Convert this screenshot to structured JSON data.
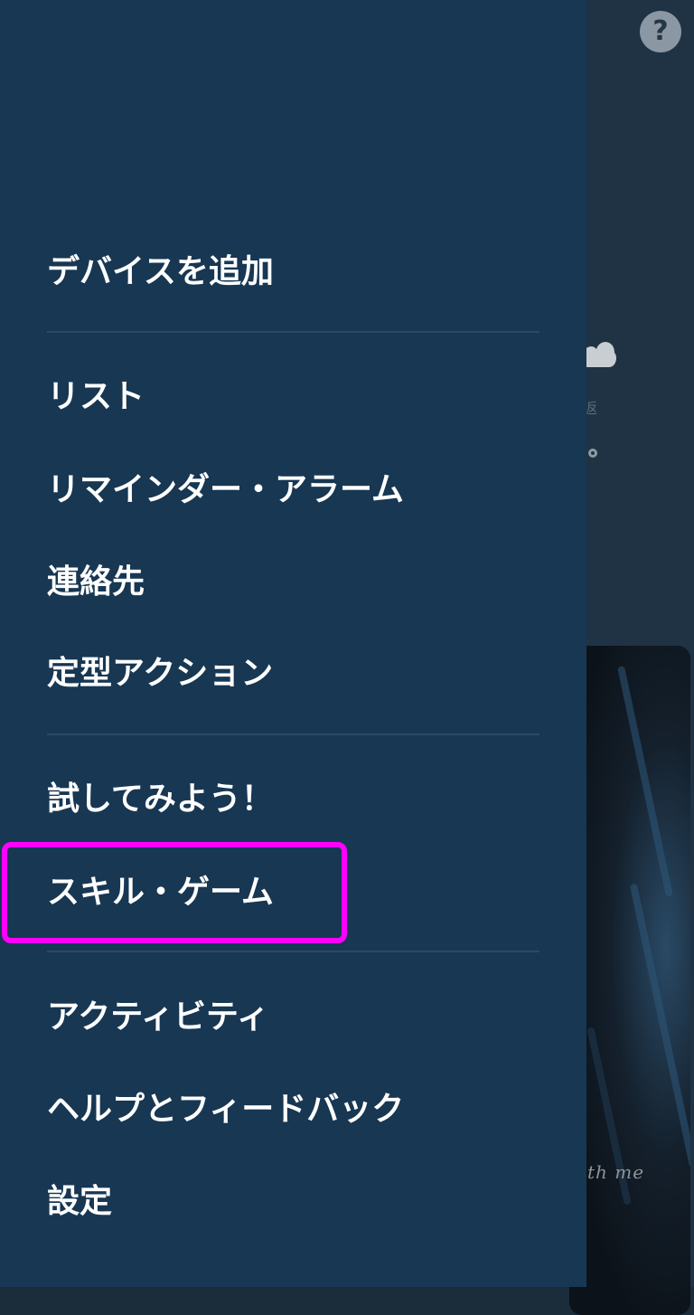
{
  "background_app": {
    "help_button_label": "?",
    "weather_fragment": "返",
    "media_caption": "th me"
  },
  "drawer": {
    "items": [
      {
        "label": "デバイスを追加"
      },
      {
        "label": "リスト"
      },
      {
        "label": "リマインダー・アラーム"
      },
      {
        "label": "連絡先"
      },
      {
        "label": "定型アクション"
      },
      {
        "label": "試してみよう！"
      },
      {
        "label": "スキル・ゲーム",
        "highlighted": true
      },
      {
        "label": "アクティビティ"
      },
      {
        "label": "ヘルプとフィードバック"
      },
      {
        "label": "設定"
      }
    ]
  },
  "colors": {
    "drawer_background": "#173753",
    "highlight": "#ff00ff",
    "text": "#ffffff"
  }
}
